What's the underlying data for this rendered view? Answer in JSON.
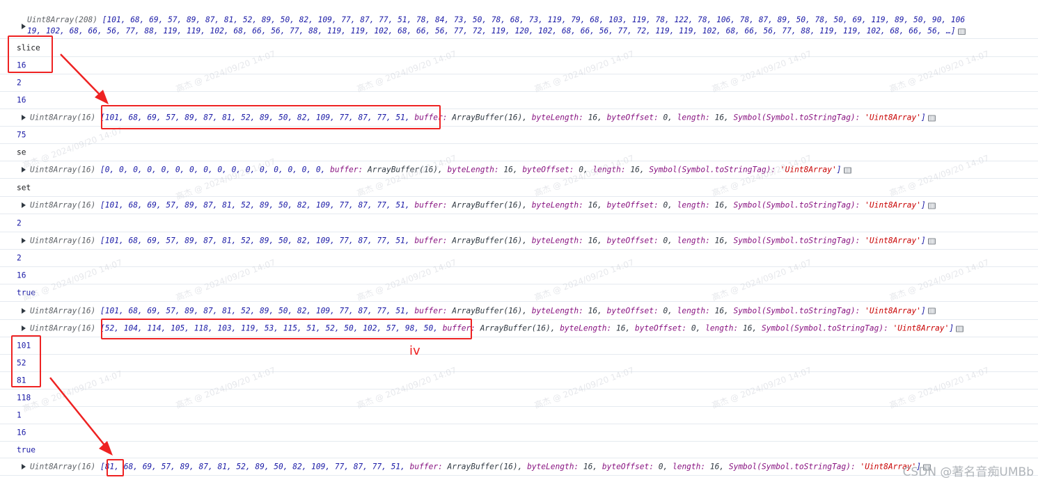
{
  "console": {
    "top_array": {
      "prefix": "Uint8Array(208) ",
      "line1": "[101, 68, 69, 57, 89, 87, 81, 52, 89, 50, 82, 109, 77, 87, 77, 51, 78, 84, 73, 50, 78, 68, 73, 119, 79, 68, 103, 119, 78, 122, 78, 106, 78, 87, 89, 50, 78, 50, 69, 119, 89, 50, 90, 106",
      "line2": "19, 102, 68, 66, 56, 77, 88, 119, 119, 102, 68, 66, 56, 77, 88, 119, 119, 102, 68, 66, 56, 77, 72, 119, 120, 102, 68, 66, 56, 77, 72, 119, 119, 102, 68, 66, 56, 77, 88, 119, 119, 102, 68, 66, 56, …]"
    },
    "texts": {
      "slice": "slice",
      "n16a": "16",
      "n2a": "2",
      "n16b": "16",
      "n75": "75",
      "se": "se",
      "set": "set",
      "n2b": "2",
      "n2c": "2",
      "n16c": "16",
      "true_a": "true",
      "n101": "101",
      "n52": "52",
      "n81": "81",
      "n118": "118",
      "n1": "1",
      "n16d": "16",
      "true_b": "true"
    },
    "tail": {
      "buffer_key": "buffer:",
      "buffer_val": "ArrayBuffer(16),",
      "bl_key": "byteLength:",
      "bl_val": "16,",
      "bo_key": "byteOffset:",
      "bo_val": "0,",
      "len_key": "length:",
      "len_val": "16,",
      "sym_key": "Symbol(Symbol.toStringTag):",
      "sym_val": "'Uint8Array'",
      "close": "]"
    },
    "array_prefix": "Uint8Array(16) ",
    "arrays": {
      "a1": "[101, 68, 69, 57, 89, 87, 81, 52, 89, 50, 82, 109, 77, 87, 77, 51,",
      "a2": "[0, 0, 0, 0, 0, 0, 0, 0, 0, 0, 0, 0, 0, 0, 0, 0,",
      "a3": "[101, 68, 69, 57, 89, 87, 81, 52, 89, 50, 82, 109, 77, 87, 77, 51,",
      "a4": "[101, 68, 69, 57, 89, 87, 81, 52, 89, 50, 82, 109, 77, 87, 77, 51,",
      "a5": "[101, 68, 69, 57, 89, 87, 81, 52, 89, 50, 82, 109, 77, 87, 77, 51,",
      "a6": "[52, 104, 114, 105, 118, 103, 119, 53, 115, 51, 52, 50, 102, 57, 98, 50,",
      "a7_open": "[",
      "a7_first": "81",
      "a7_rest": ", 68, 69, 57, 89, 87, 81, 52, 89, 50, 82, 109, 77, 87, 77, 51,"
    }
  },
  "annotation": {
    "iv_label": "iv"
  },
  "watermark": {
    "text": "高杰 @ 2024/09/20 14:07",
    "color": "#c8ccd4"
  },
  "site_watermark": "CSDN @著名音痴UMBb",
  "colors": {
    "annotation": "#ee2222",
    "number": "#1a1aa6",
    "key": "#881280",
    "string": "#c80000"
  }
}
